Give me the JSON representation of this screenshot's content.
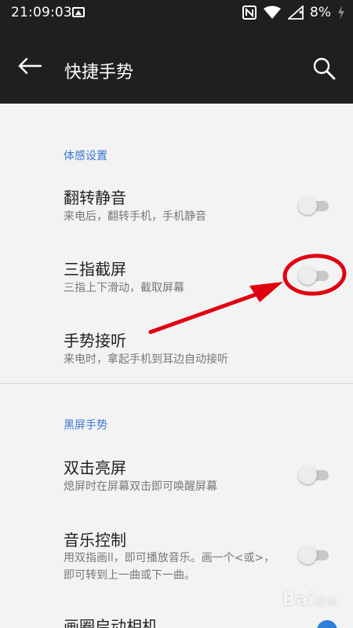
{
  "status_bar": {
    "time": "21:09:03",
    "battery": "8%",
    "icons": [
      "image-notification-icon",
      "nfc-icon",
      "wifi-icon",
      "signal-icon",
      "battery-icon",
      "charging-icon"
    ]
  },
  "toolbar": {
    "title": "快捷手势",
    "back_icon": "arrow-left-icon",
    "search_icon": "search-icon",
    "background": "#1f1f1f"
  },
  "sections": [
    {
      "title": "体感设置",
      "items": [
        {
          "title": "翻转静音",
          "subtitle": "来电后，翻转手机，手机静音",
          "toggle": false
        },
        {
          "title": "三指截屏",
          "subtitle": "三指上下滑动，截取屏幕",
          "toggle": false
        },
        {
          "title": "手势接听",
          "subtitle": "来电时，拿起手机到耳边自动接听"
        }
      ]
    },
    {
      "title": "黑屏手势",
      "items": [
        {
          "title": "双击亮屏",
          "subtitle": "熄屏时在屏幕双击即可唤醒屏幕",
          "toggle": false
        },
        {
          "title": "音乐控制",
          "subtitle": "用双指画ll，即可播放音乐。画一个<或>，即可转到上一曲或下一曲。",
          "toggle": false
        },
        {
          "title": "画圈启动相机",
          "toggle": true
        }
      ]
    }
  ],
  "accent_color": "#3a76d0",
  "annotation_color": "#e00010",
  "watermark": {
    "brand": "Bai",
    "suffix": "经验"
  }
}
